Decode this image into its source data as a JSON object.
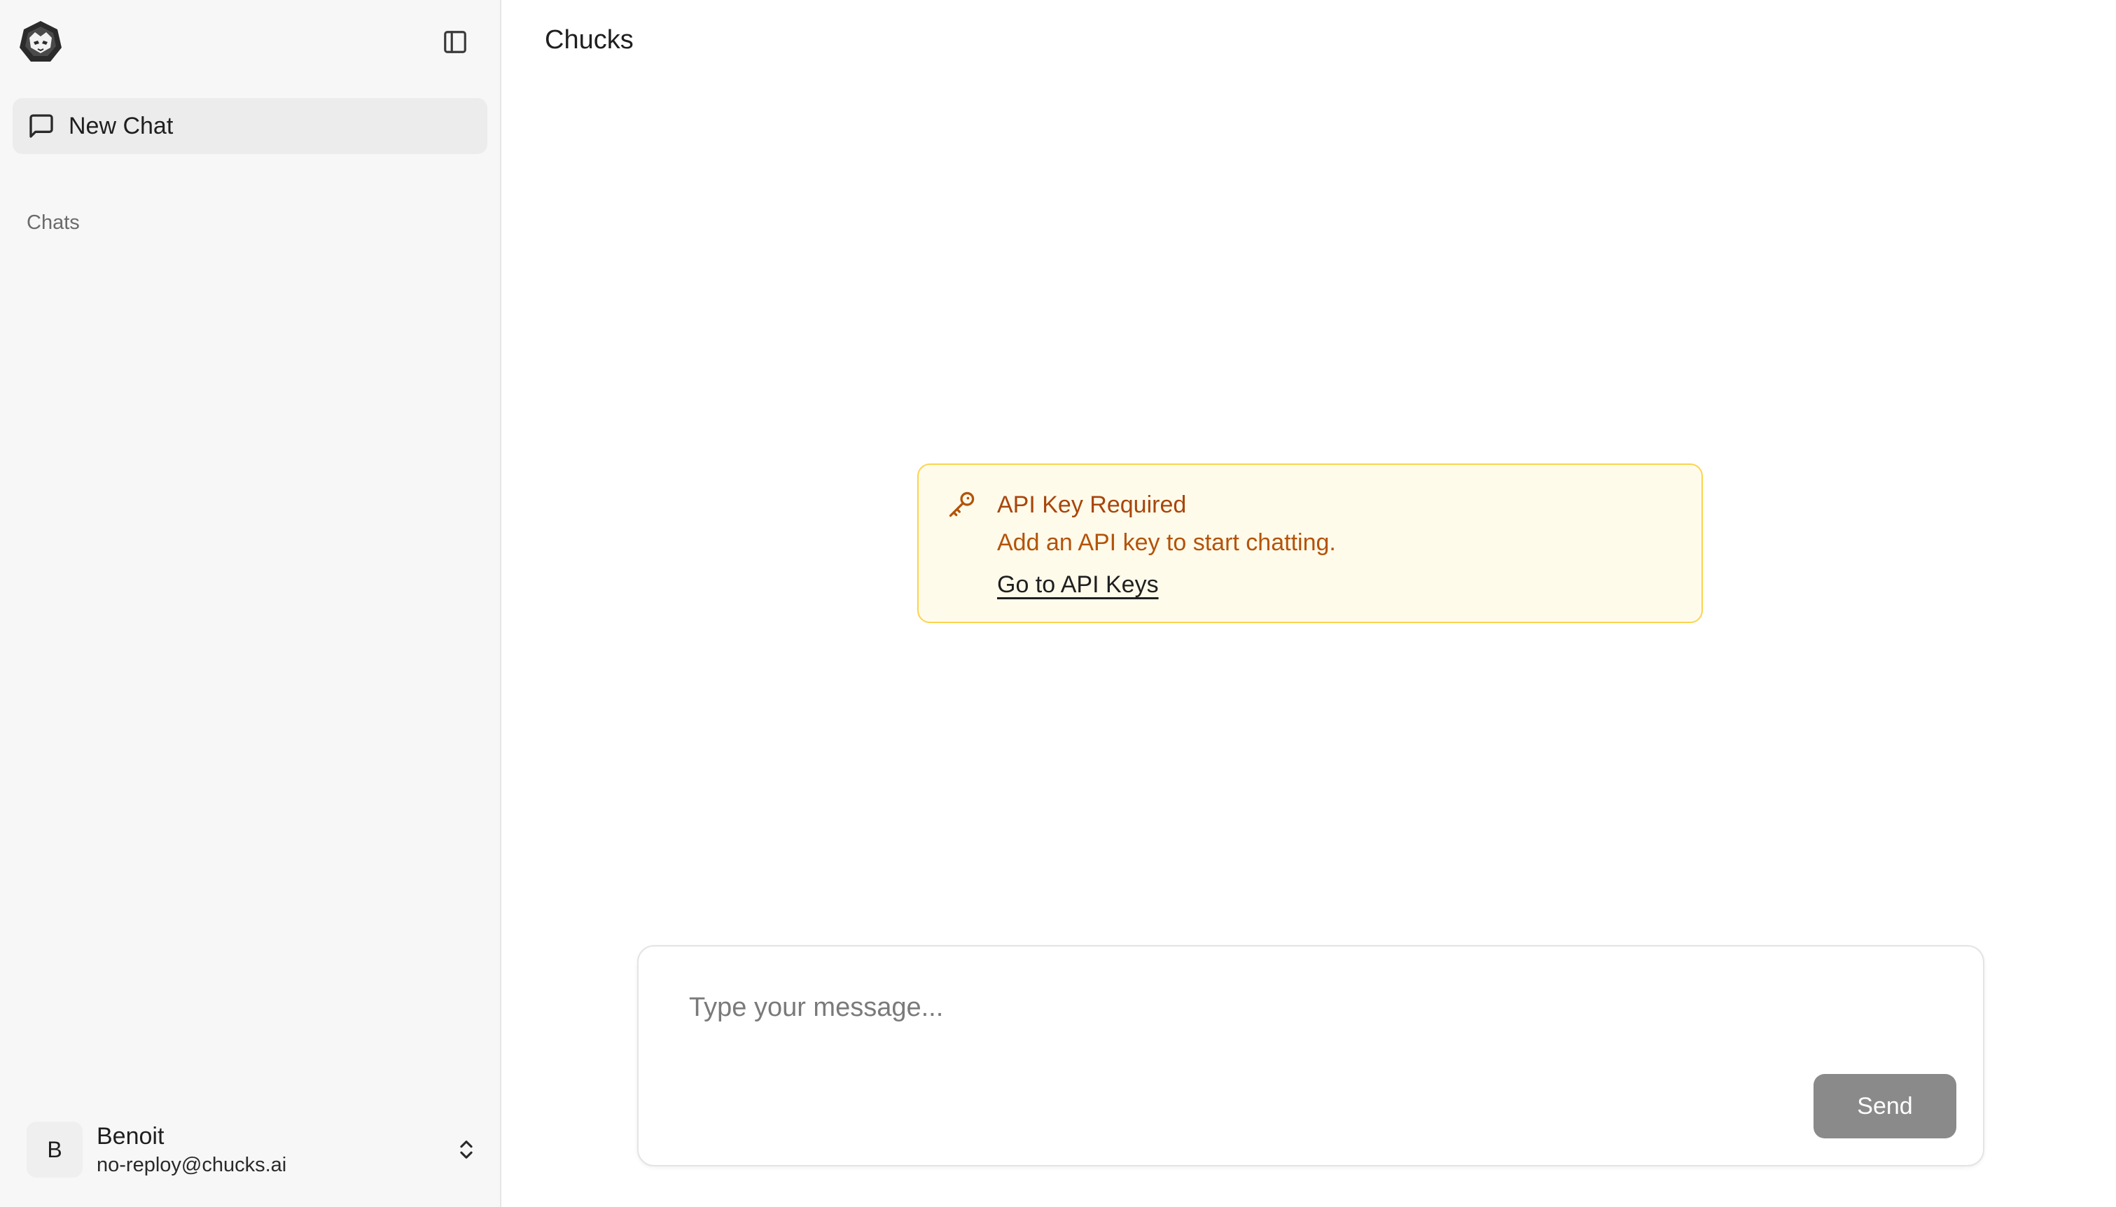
{
  "app": {
    "title": "Chucks",
    "logo_icon": "chucks-logo-icon"
  },
  "sidebar": {
    "toggle_icon": "sidebar-panel-icon",
    "new_chat": {
      "label": "New Chat",
      "icon": "chat-bubble-icon"
    },
    "section_label": "Chats",
    "chats": [],
    "user": {
      "initial": "B",
      "name": "Benoit",
      "email": "no-reploy@chucks.ai",
      "menu_icon": "chevron-up-down-icon"
    }
  },
  "alert": {
    "icon": "key-icon",
    "title": "API Key Required",
    "description": "Add an API key to start chatting.",
    "link_label": "Go to API Keys"
  },
  "composer": {
    "placeholder": "Type your message...",
    "value": "",
    "send_label": "Send"
  },
  "colors": {
    "sidebar_bg": "#f7f7f7",
    "alert_bg": "#fffbeb",
    "alert_border": "#fcd34d",
    "alert_text": "#b45309",
    "send_button_disabled": "#8a8a8a"
  }
}
